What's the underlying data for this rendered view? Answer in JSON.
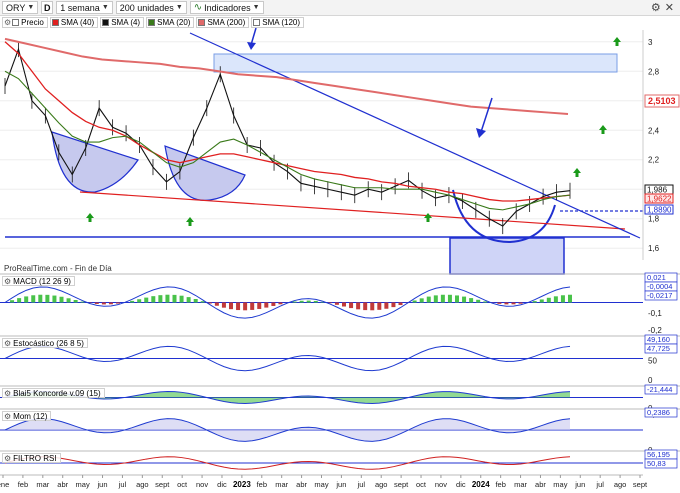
{
  "toolbar": {
    "symbol": "ORY",
    "letter": "D",
    "period": "1 semana",
    "units": "200 unidades",
    "indicators_label": "Indicadores"
  },
  "legend": {
    "price": "Precio",
    "sma40": "SMA (40)",
    "sma4": "SMA (4)",
    "sma20": "SMA (20)",
    "sma200": "SMA (200)",
    "sma120": "SMA (120)"
  },
  "colors": {
    "price": "#111111",
    "sma40": "#e02020",
    "sma4": "#111111",
    "sma20": "#3a7a1a",
    "sma200": "#e06a6a",
    "sma120": "#ffffff",
    "trendline": "#2030d0",
    "arrow_green": "#1a9a1a",
    "macd_hist": "#49c24a",
    "panel_line": "#2030d0"
  },
  "watermark": "ProRealTime.com - Fin de Día",
  "panels": {
    "macd": "MACD (12 26 9)",
    "stoch": "Estocástico (26 8 5)",
    "koncorde": "Blai5 Koncorde v.09 (15)",
    "mom": "Mom (12)",
    "rsi": "FILTRO RSI"
  },
  "chart_data": [
    {
      "type": "line",
      "name": "price",
      "x_labels": [
        "ene",
        "feb",
        "mar",
        "abr",
        "may",
        "jun",
        "jul",
        "ago",
        "sept",
        "oct",
        "nov",
        "dic",
        "2023",
        "feb",
        "mar",
        "abr",
        "may",
        "jun",
        "jul",
        "ago",
        "sept",
        "oct",
        "nov",
        "dic",
        "2024",
        "feb",
        "mar",
        "abr",
        "may",
        "jun",
        "jul",
        "ago",
        "sept"
      ],
      "y_ticks": [
        "3",
        "2,8",
        "2,6",
        "2,4",
        "2,2",
        "2",
        "1,8",
        "1,6"
      ],
      "ylim": [
        1.52,
        3.08
      ],
      "series": [
        {
          "name": "Precio",
          "values": [
            2.7,
            2.95,
            2.6,
            2.5,
            2.25,
            2.1,
            2.28,
            2.55,
            2.42,
            2.38,
            2.3,
            2.15,
            2.05,
            2.12,
            2.35,
            2.55,
            2.78,
            2.5,
            2.3,
            2.28,
            2.18,
            2.12,
            2.04,
            2.02,
            2.0,
            1.98,
            1.96,
            2.0,
            1.98,
            2.02,
            2.06,
            1.99,
            1.94,
            1.96,
            1.92,
            1.86,
            1.8,
            1.75,
            1.85,
            1.9,
            1.95,
            1.98,
            1.99
          ]
        },
        {
          "name": "SMA (40)",
          "values": [
            3.0,
            2.92,
            2.8,
            2.68,
            2.6,
            2.52,
            2.46,
            2.42,
            2.4,
            2.36,
            2.3,
            2.25,
            2.2,
            2.18,
            2.2,
            2.22,
            2.24,
            2.24,
            2.22,
            2.2,
            2.18,
            2.16,
            2.14,
            2.12,
            2.11,
            2.1,
            2.08,
            2.07,
            2.05,
            2.04,
            2.02,
            2.01,
            2.0,
            1.98,
            1.97,
            1.95,
            1.93,
            1.92,
            1.92,
            1.93,
            1.94,
            1.95,
            1.96
          ]
        },
        {
          "name": "SMA (20)",
          "values": [
            2.8,
            2.75,
            2.65,
            2.55,
            2.45,
            2.36,
            2.32,
            2.32,
            2.35,
            2.36,
            2.32,
            2.25,
            2.18,
            2.15,
            2.18,
            2.25,
            2.32,
            2.34,
            2.3,
            2.25,
            2.2,
            2.15,
            2.1,
            2.07,
            2.05,
            2.03,
            2.01,
            2.01,
            2.01,
            2.0,
            2.0,
            2.0,
            1.98,
            1.96,
            1.93,
            1.9,
            1.87,
            1.86,
            1.88,
            1.9,
            1.93,
            1.95,
            1.96
          ]
        },
        {
          "name": "SMA (200)",
          "values": [
            3.02,
            2.99,
            2.96,
            2.93,
            2.9,
            2.88,
            2.87,
            2.86,
            2.85,
            2.83,
            2.82,
            2.8,
            2.78,
            2.77,
            2.76,
            2.74,
            2.72,
            2.7,
            2.68,
            2.66,
            2.64,
            2.62,
            2.6,
            2.58,
            2.56,
            2.55,
            2.54,
            2.53,
            2.52,
            2.51
          ]
        }
      ],
      "last_values": {
        "sma200": "2,5103",
        "price": "1,986",
        "sma40": "1,9622",
        "level": "1,8890"
      }
    },
    {
      "type": "bar",
      "name": "MACD (12 26 9)",
      "y_ticks": [
        "0,1",
        "0",
        "-0,1",
        "-0,2"
      ],
      "last_values": [
        "0,021",
        "-0,0004",
        "-0,0217"
      ]
    },
    {
      "type": "line",
      "name": "Estocástico (26 8 5)",
      "y_ticks": [
        "100",
        "50",
        "0"
      ],
      "last_values": [
        "49,160",
        "47,725"
      ]
    },
    {
      "type": "area",
      "name": "Blai5 Koncorde v.09 (15)",
      "y_ticks": [
        "200",
        "0"
      ],
      "last_values": [
        "-21,444"
      ]
    },
    {
      "type": "area",
      "name": "Mom (12)",
      "y_ticks": [
        "0,2",
        "0"
      ],
      "last_values": [
        "0,2386"
      ]
    },
    {
      "type": "line",
      "name": "FILTRO RSI",
      "y_ticks": [
        "100"
      ],
      "last_values": [
        "56,195",
        "50,83"
      ]
    }
  ]
}
